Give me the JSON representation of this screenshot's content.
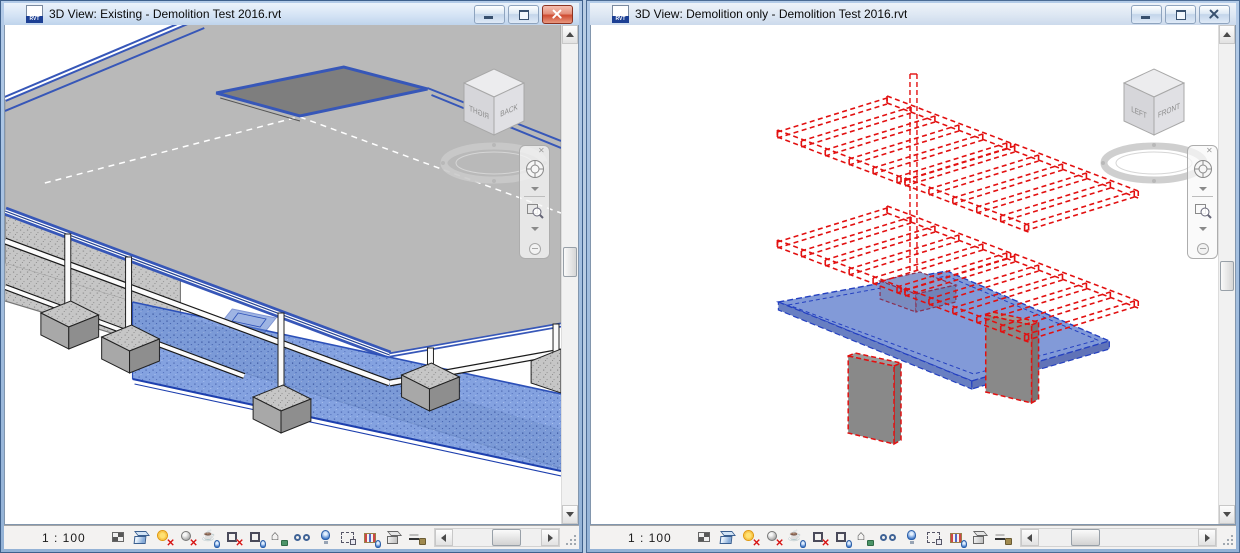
{
  "file_icon_label": "RVT",
  "colors": {
    "selection_blue": "#3757b8",
    "demolished_red": "#e21010",
    "slab_fill_blue": "#7b95d6",
    "concrete_gray": "#c6c6c6",
    "mdi_background": "#b9cde4"
  },
  "window_controls": {
    "minimize": "minimize",
    "restore": "restore",
    "close": "close"
  },
  "view_bar_icons": [
    "detail-level",
    "visual-style",
    "sun-path-off",
    "shadows-off",
    "show-rendering-dialog",
    "crop-view-off",
    "show-crop-region",
    "locked-3d-view",
    "temporary-hide-isolate",
    "reveal-hidden-elements",
    "temporary-view-properties",
    "show-analytical-model",
    "highlight-displacement-sets",
    "reveal-constraints"
  ],
  "left_window": {
    "title": "3D View: Existing - Demolition Test 2016.rvt",
    "state": "active",
    "scale_label": "1 : 100",
    "viewcube": {
      "left_face": "RIGHT",
      "right_face": "BACK"
    }
  },
  "right_window": {
    "title": "3D View: Demolition only - Demolition Test 2016.rvt",
    "state": "inactive",
    "scale_label": "1 : 100",
    "viewcube": {
      "left_face": "LEFT",
      "right_face": "FRONT"
    }
  }
}
